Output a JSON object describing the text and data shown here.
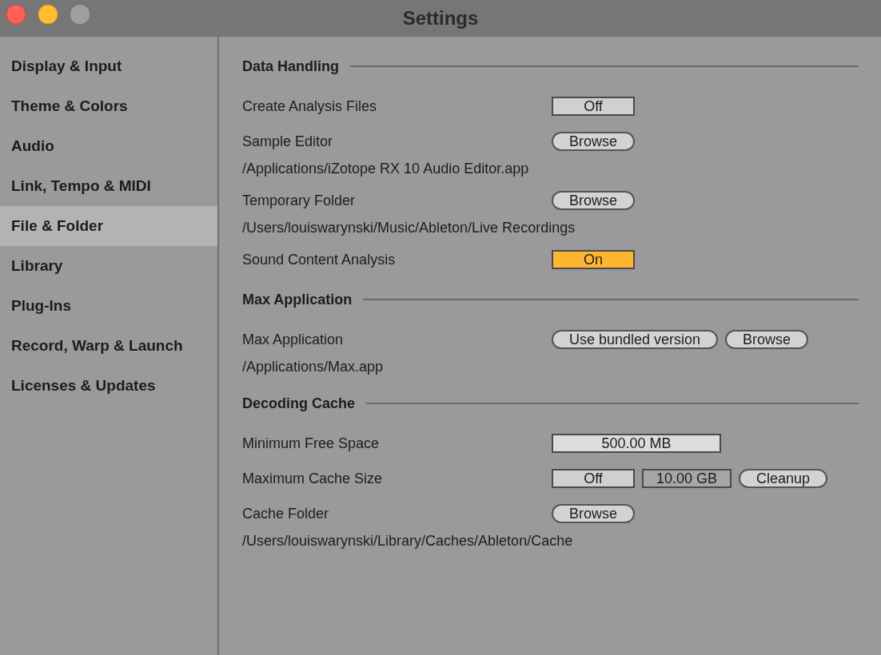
{
  "window": {
    "title": "Settings"
  },
  "window_buttons": [
    {
      "kind": "close",
      "disabled": false
    },
    {
      "kind": "minimize",
      "disabled": false
    },
    {
      "kind": "zoom",
      "disabled": true
    }
  ],
  "sidebar": {
    "items": [
      {
        "label": "Display & Input",
        "selected": false
      },
      {
        "label": "Theme & Colors",
        "selected": false
      },
      {
        "label": "Audio",
        "selected": false
      },
      {
        "label": "Link, Tempo & MIDI",
        "selected": false
      },
      {
        "label": "File & Folder",
        "selected": true
      },
      {
        "label": "Library",
        "selected": false
      },
      {
        "label": "Plug-Ins",
        "selected": false
      },
      {
        "label": "Record, Warp & Launch",
        "selected": false
      },
      {
        "label": "Licenses & Updates",
        "selected": false
      }
    ]
  },
  "sections": [
    {
      "title": "Data Handling",
      "rows": [
        {
          "kind": "setting",
          "label": "Create Analysis Files",
          "controls": [
            {
              "kind": "toggle",
              "label": "Off",
              "on": false
            }
          ]
        },
        {
          "kind": "setting",
          "label": "Sample Editor",
          "controls": [
            {
              "kind": "button",
              "label": "Browse"
            }
          ]
        },
        {
          "kind": "path",
          "text": "/Applications/iZotope RX 10 Audio Editor.app"
        },
        {
          "kind": "setting",
          "label": "Temporary Folder",
          "controls": [
            {
              "kind": "button",
              "label": "Browse"
            }
          ]
        },
        {
          "kind": "path",
          "text": "/Users/louiswarynski/Music/Ableton/Live Recordings"
        },
        {
          "kind": "setting",
          "label": "Sound Content Analysis",
          "controls": [
            {
              "kind": "toggle",
              "label": "On",
              "on": true
            }
          ]
        }
      ]
    },
    {
      "title": "Max Application",
      "rows": [
        {
          "kind": "setting",
          "label": "Max Application",
          "controls": [
            {
              "kind": "button",
              "label": "Use bundled version"
            },
            {
              "kind": "button",
              "label": "Browse"
            }
          ]
        },
        {
          "kind": "path",
          "text": "/Applications/Max.app"
        }
      ]
    },
    {
      "title": "Decoding Cache",
      "rows": [
        {
          "kind": "setting",
          "label": "Minimum Free Space",
          "controls": [
            {
              "kind": "field",
              "value": "500.00 MB",
              "disabled": false
            }
          ]
        },
        {
          "kind": "setting",
          "label": "Maximum Cache Size",
          "controls": [
            {
              "kind": "toggle",
              "label": "Off",
              "on": false
            },
            {
              "kind": "field",
              "value": "10.00 GB",
              "disabled": true
            },
            {
              "kind": "button",
              "label": "Cleanup"
            }
          ]
        },
        {
          "kind": "setting",
          "label": "Cache Folder",
          "controls": [
            {
              "kind": "button",
              "label": "Browse"
            }
          ]
        },
        {
          "kind": "path",
          "text": "/Users/louiswarynski/Library/Caches/Ableton/Cache"
        }
      ]
    }
  ]
}
